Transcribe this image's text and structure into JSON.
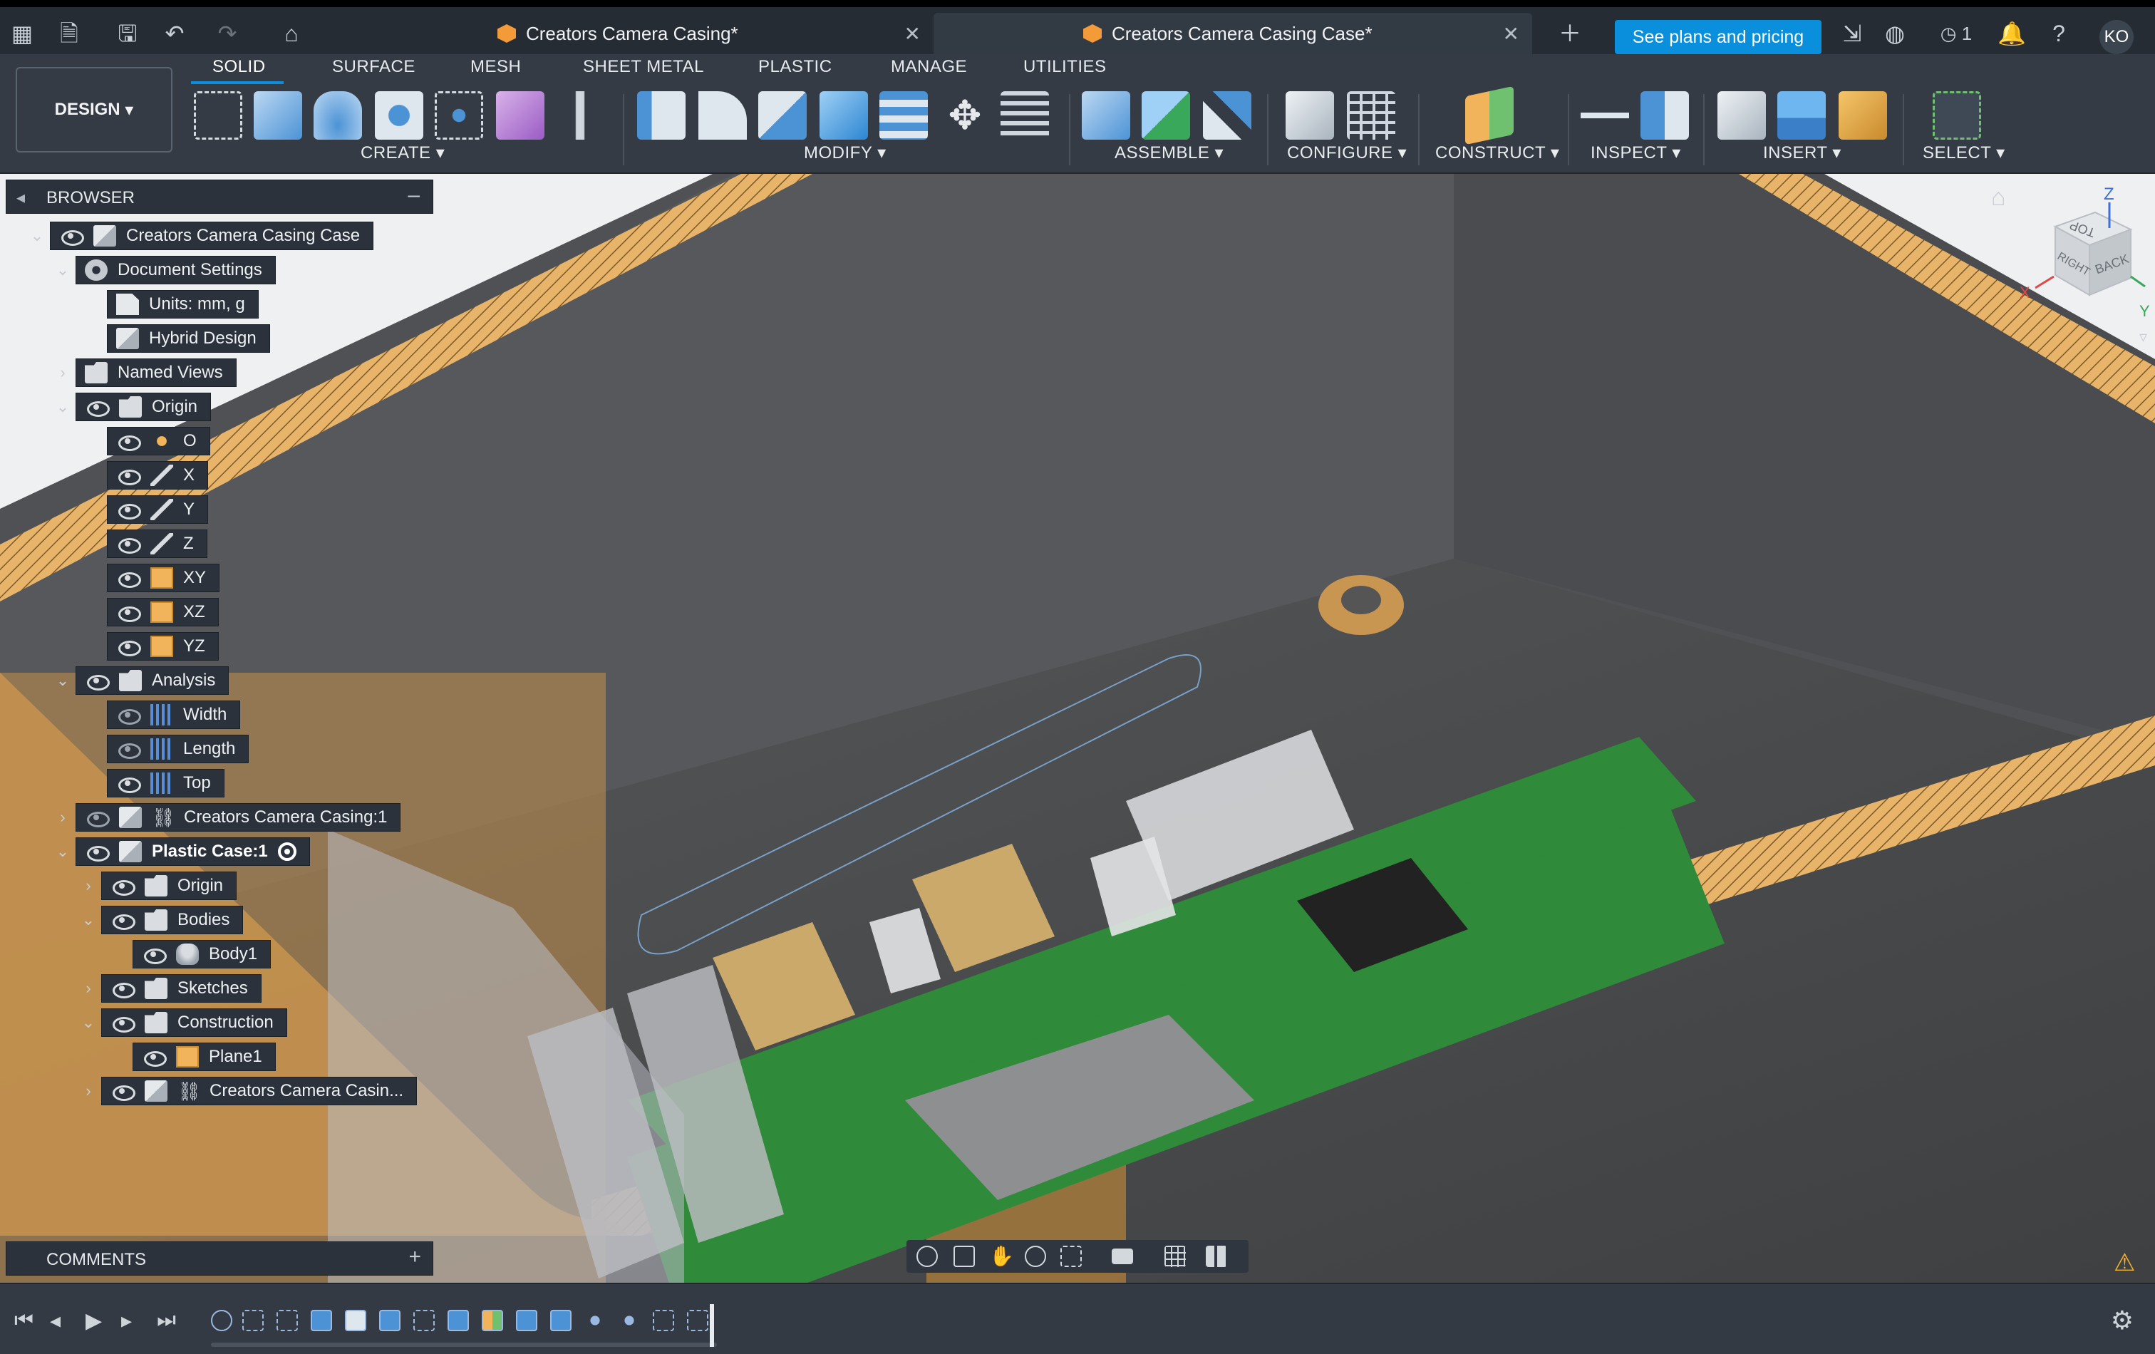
{
  "titlebar": {
    "tabs": [
      {
        "label": "Creators Camera Casing*"
      },
      {
        "label": "Creators Camera Casing Case*"
      }
    ],
    "plans_button": "See plans and pricing",
    "jobs_count": "1",
    "avatar_initials": "KO"
  },
  "toolbar": {
    "workspace": "DESIGN",
    "tabs": [
      "SOLID",
      "SURFACE",
      "MESH",
      "SHEET METAL",
      "PLASTIC",
      "MANAGE",
      "UTILITIES"
    ],
    "groups": [
      "CREATE",
      "MODIFY",
      "ASSEMBLE",
      "CONFIGURE",
      "CONSTRUCT",
      "INSPECT",
      "INSERT",
      "SELECT"
    ]
  },
  "browser": {
    "title": "BROWSER",
    "nodes": [
      {
        "label": "Creators Camera Casing Case"
      },
      {
        "label": "Document Settings"
      },
      {
        "label": "Units: mm, g"
      },
      {
        "label": "Hybrid Design"
      },
      {
        "label": "Named Views"
      },
      {
        "label": "Origin"
      },
      {
        "label": "O"
      },
      {
        "label": "X"
      },
      {
        "label": "Y"
      },
      {
        "label": "Z"
      },
      {
        "label": "XY"
      },
      {
        "label": "XZ"
      },
      {
        "label": "YZ"
      },
      {
        "label": "Analysis"
      },
      {
        "label": "Width"
      },
      {
        "label": "Length"
      },
      {
        "label": "Top"
      },
      {
        "label": "Creators Camera Casing:1"
      },
      {
        "label": "Plastic Case:1"
      },
      {
        "label": "Origin"
      },
      {
        "label": "Bodies"
      },
      {
        "label": "Body1"
      },
      {
        "label": "Sketches"
      },
      {
        "label": "Construction"
      },
      {
        "label": "Plane1"
      },
      {
        "label": "Creators Camera Casin..."
      }
    ]
  },
  "comments": {
    "title": "COMMENTS"
  },
  "viewcube": {
    "top": "TOP",
    "right": "RIGHT",
    "back": "BACK",
    "axis_x": "X",
    "axis_y": "Y",
    "axis_z": "Z"
  },
  "colors": {
    "accent": "#0a8fdc",
    "section_hatch": "#e8b46a",
    "pcb": "#2f8a3a"
  }
}
